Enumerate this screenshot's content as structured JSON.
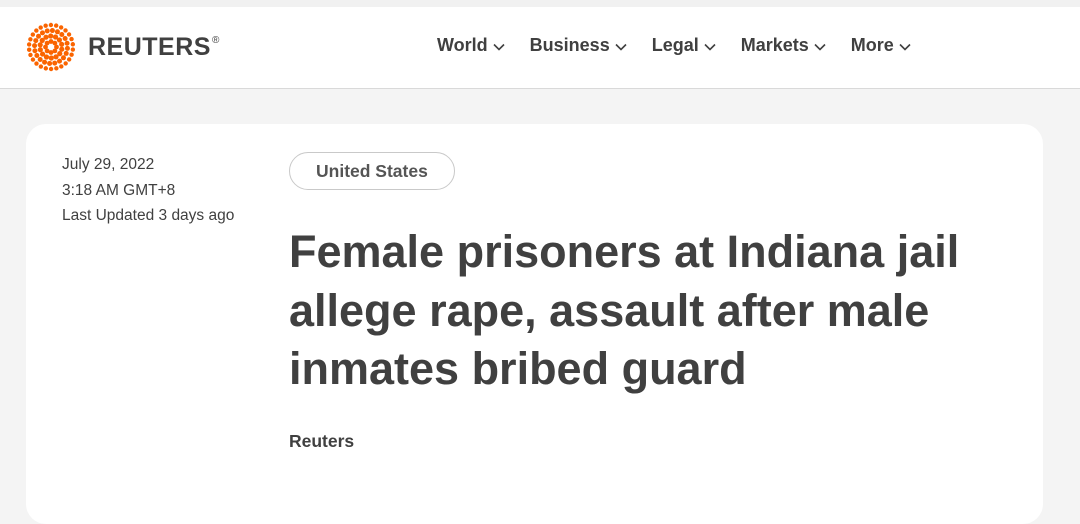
{
  "brand": {
    "name": "REUTERS",
    "registered": "®",
    "logo_color": "#fa6400"
  },
  "nav": {
    "items": [
      {
        "label": "World",
        "icon": "chevron-down-icon"
      },
      {
        "label": "Business",
        "icon": "chevron-down-icon"
      },
      {
        "label": "Legal",
        "icon": "chevron-down-icon"
      },
      {
        "label": "Markets",
        "icon": "chevron-down-icon"
      },
      {
        "label": "More",
        "icon": "chevron-down-icon"
      }
    ]
  },
  "article": {
    "date": "July 29, 2022",
    "time": "3:18 AM GMT+8",
    "updated": "Last Updated 3 days ago",
    "section_tag": "United States",
    "headline": "Female prisoners at Indiana jail allege rape, assault after male inmates bribed guard",
    "byline": "Reuters"
  }
}
